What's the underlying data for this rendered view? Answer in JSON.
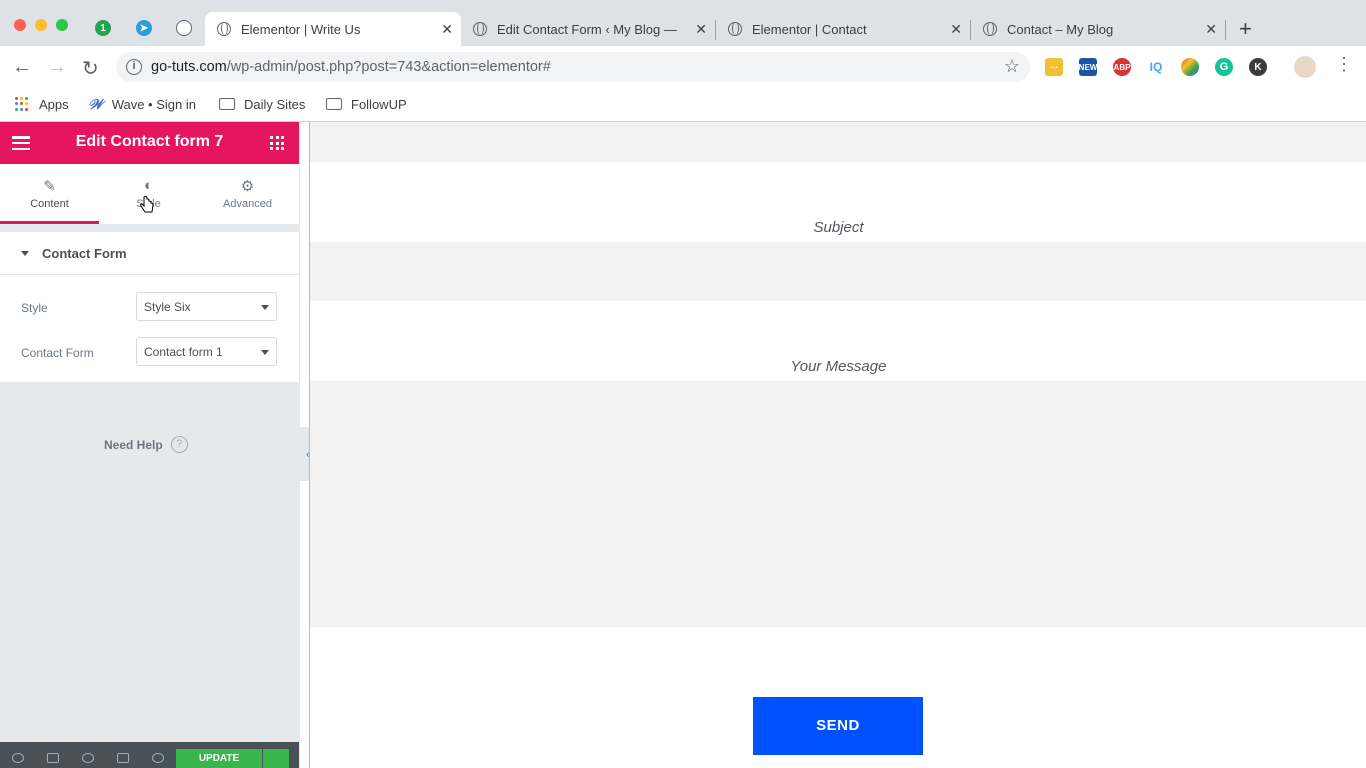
{
  "browser": {
    "tabs": [
      {
        "title": "Elementor | Write Us",
        "active": true
      },
      {
        "title": "Edit Contact Form ‹ My Blog —",
        "active": false
      },
      {
        "title": "Elementor | Contact",
        "active": false
      },
      {
        "title": "Contact – My Blog",
        "active": false
      }
    ],
    "url_domain": "go-tuts.com",
    "url_path": "/wp-admin/post.php?post=743&action=elementor#",
    "extensions": [
      {
        "name": "new-extension-icon",
        "label": "NEW",
        "color": "#1a56a8"
      },
      {
        "name": "adblock-icon",
        "label": "ABP",
        "color": "#d9322f"
      },
      {
        "name": "iq-icon",
        "label": "IQ",
        "color": "#3fa9f5"
      },
      {
        "name": "grammarly-icon",
        "label": "G",
        "color": "#15c39a"
      },
      {
        "name": "k-icon",
        "label": "K",
        "color": "#3c3c3c"
      }
    ],
    "bookmarks": [
      "Apps",
      "Wave • Sign in",
      "Daily Sites",
      "FollowUP"
    ]
  },
  "panel": {
    "header_title": "Edit Contact form 7",
    "tabs": [
      "Content",
      "Style",
      "Advanced"
    ],
    "section_title": "Contact Form",
    "style_label": "Style",
    "style_value": "Style Six",
    "form_label": "Contact Form",
    "form_value": "Contact form 1",
    "need_help": "Need Help",
    "update_label": "UPDATE",
    "accent_color": "#e6155f"
  },
  "preview": {
    "subject_label": "Subject",
    "message_label": "Your Message",
    "send_label": "SEND",
    "send_color": "#0051ff"
  }
}
